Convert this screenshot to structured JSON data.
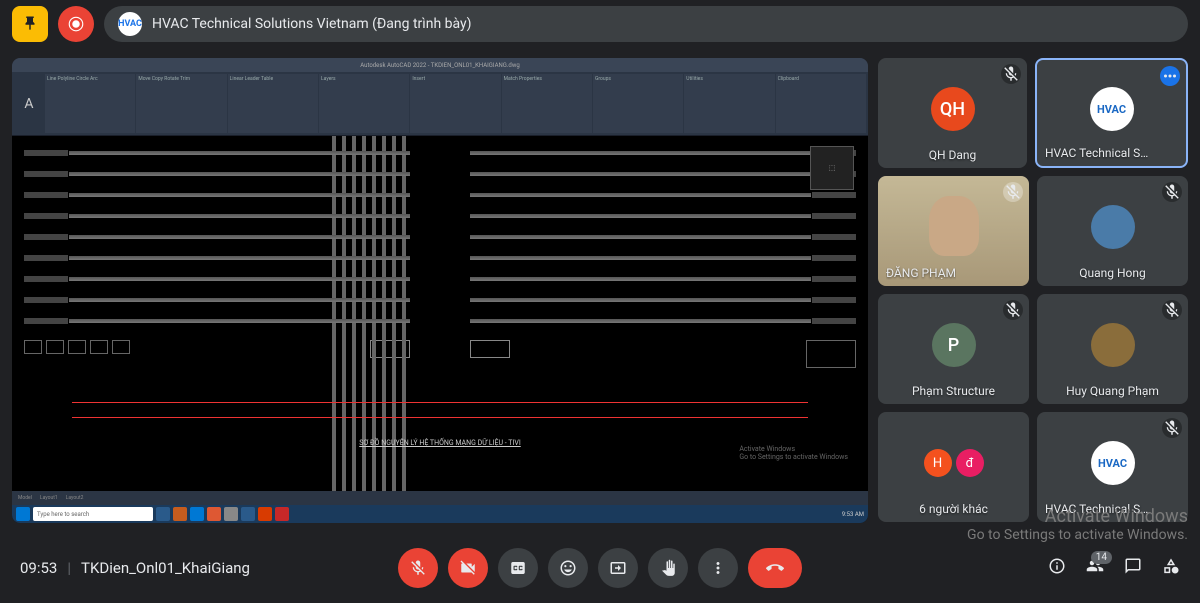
{
  "header": {
    "presenter_avatar": "HVAC",
    "presenter_label": "HVAC Technical Solutions Vietnam (Đang trình bày)"
  },
  "share": {
    "cad_title": "Autodesk AutoCAD 2022 - TKDIEN_ONL01_KHAIGIANG.dwg",
    "drawing_title": "SƠ ĐỒ NGUYÊN LÝ HỆ THỐNG MẠNG DỮ LIỆU - TIVI",
    "watermark_1": "Activate Windows",
    "watermark_2": "Go to Settings to activate Windows",
    "status": "Model",
    "taskbar_search": "Type here to search",
    "taskbar_time": "9:53 AM"
  },
  "participants": {
    "r1": [
      {
        "name": "QH Dang",
        "initials": "QH",
        "color": "#e8491d",
        "muted": true
      },
      {
        "name": "HVAC Technical S…",
        "type": "logo",
        "speaking": true,
        "active": true
      }
    ],
    "r2": [
      {
        "name": "ĐĂNG PHẠM",
        "type": "video",
        "muted": true
      },
      {
        "name": "Quang Hong",
        "type": "photo",
        "color": "#4a7ba8",
        "muted": true
      }
    ],
    "r3": [
      {
        "name": "Phạm Structure",
        "initials": "P",
        "color": "#5a7560",
        "muted": true
      },
      {
        "name": "Huy Quang Phạm",
        "type": "photo",
        "color": "#8a6d3b",
        "muted": true
      }
    ],
    "r4": [
      {
        "name": "6 người khác",
        "type": "others",
        "others": [
          {
            "i": "H",
            "c": "#f4511e"
          },
          {
            "i": "đ",
            "c": "#e91e63"
          }
        ]
      },
      {
        "name": "HVAC Technical S…",
        "type": "logo",
        "muted": true
      }
    ]
  },
  "footer": {
    "time": "09:53",
    "meeting": "TKDien_Onl01_KhaiGiang",
    "badge": "14"
  },
  "watermark": {
    "line1": "Activate Windows",
    "line2": "Go to Settings to activate Windows."
  }
}
